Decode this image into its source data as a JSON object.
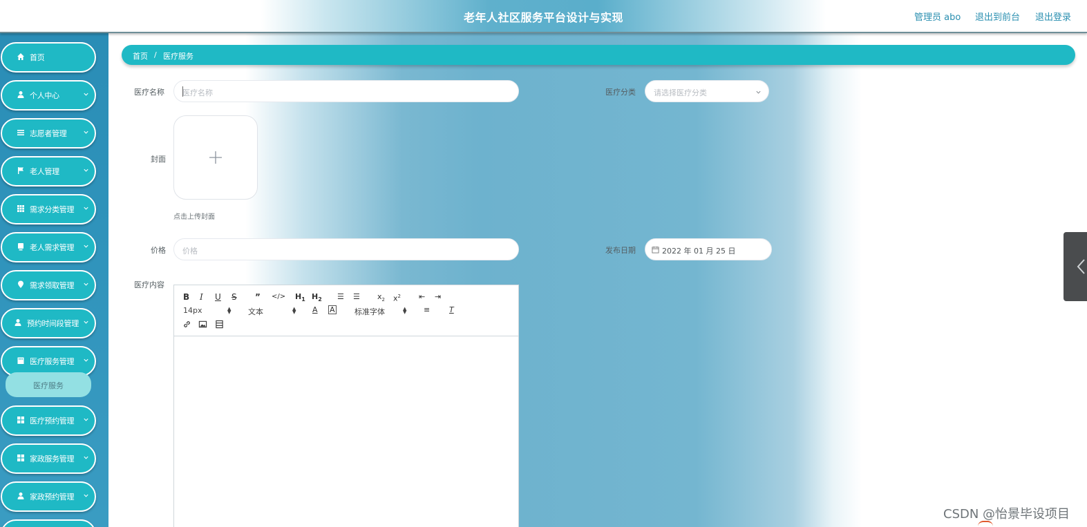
{
  "header": {
    "title": "老年人社区服务平台设计与实现",
    "admin_label": "管理员 abo",
    "to_front_label": "退出到前台",
    "logout_label": "退出登录"
  },
  "sidebar": {
    "items": [
      {
        "label": "首页",
        "icon": "home-icon"
      },
      {
        "label": "个人中心",
        "icon": "user-icon"
      },
      {
        "label": "志愿者管理",
        "icon": "list-icon"
      },
      {
        "label": "老人管理",
        "icon": "flag-icon"
      },
      {
        "label": "需求分类管理",
        "icon": "grid-icon"
      },
      {
        "label": "老人需求管理",
        "icon": "document-icon"
      },
      {
        "label": "需求领取管理",
        "icon": "location-pin-icon"
      },
      {
        "label": "预约时间段管理",
        "icon": "user-icon"
      },
      {
        "label": "医疗服务管理",
        "icon": "building-icon"
      },
      {
        "label": "医疗预约管理",
        "icon": "apps-icon"
      },
      {
        "label": "家政服务管理",
        "icon": "apps-icon"
      },
      {
        "label": "家政预约管理",
        "icon": "user-icon"
      }
    ],
    "active_sub_item": "医疗服务"
  },
  "breadcrumb": {
    "home": "首页",
    "separator": "/",
    "current": "医疗服务"
  },
  "form": {
    "name_label": "医疗名称",
    "name_placeholder": "医疗名称",
    "category_label": "医疗分类",
    "category_placeholder": "请选择医疗分类",
    "cover_label": "封面",
    "cover_hint": "点击上传封面",
    "price_label": "价格",
    "price_placeholder": "价格",
    "date_label": "发布日期",
    "date_value": "2022 年 01 月 25 日",
    "content_label": "医疗内容"
  },
  "editor": {
    "font_size": "14px",
    "header_select": "文本",
    "font_family": "标准字体",
    "buttons": [
      "bold-icon",
      "italic-icon",
      "underline-icon",
      "strikethrough-icon",
      "quote-icon",
      "code-icon",
      "h1-icon",
      "h2-icon",
      "ordered-list-icon",
      "bullet-list-icon",
      "subscript-icon",
      "superscript-icon",
      "outdent-icon",
      "indent-icon",
      "font-color-icon",
      "background-color-icon",
      "align-icon",
      "clear-format-icon",
      "link-icon",
      "image-icon",
      "video-icon"
    ]
  },
  "watermark": "CSDN @怡景毕设项目",
  "colors": {
    "accent": "#1fb9c5",
    "sidebar_bg": "#2a8db6",
    "sub_item": "#93e0e3",
    "link": "#2a8fb0"
  }
}
